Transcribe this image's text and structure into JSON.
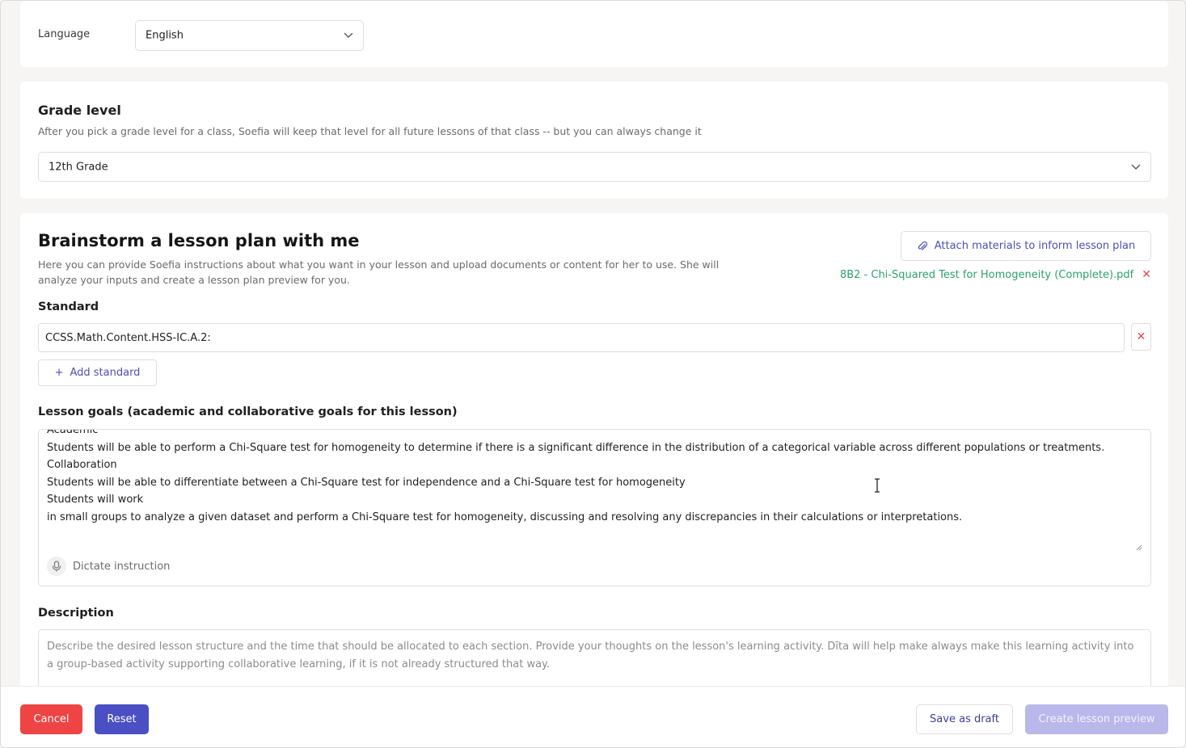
{
  "language": {
    "label": "Language",
    "value": "English"
  },
  "grade": {
    "title": "Grade level",
    "subtitle": "After you pick a grade level for a class, Soefia will keep that level for all future lessons of that class -- but you can always change it",
    "value": "12th Grade"
  },
  "brainstorm": {
    "title": "Brainstorm a lesson plan with me",
    "subtitle": "Here you can provide Soefia instructions about what you want in your lesson and upload documents or content for her to use. She will analyze your inputs and create a lesson plan preview for you.",
    "attach_label": "Attach materials to inform lesson plan",
    "attached_file": "8B2 - Chi-Squared Test for Homogeneity (Complete).pdf",
    "remove_symbol": "✕"
  },
  "standard": {
    "label": "Standard",
    "value": "CCSS.Math.Content.HSS-IC.A.2:",
    "add_label": "Add standard",
    "add_symbol": "+"
  },
  "goals": {
    "label": "Lesson goals (academic and collaborative goals for this lesson)",
    "lines": [
      "Academic",
      "Students will be able to perform a Chi-Square test for homogeneity to determine if there is a significant difference in the distribution of a categorical variable across different populations or treatments.",
      "Collaboration",
      "Students will be able to differentiate between a Chi-Square test for independence and a Chi-Square test for homogeneity",
      "Students will work",
      "in small groups to analyze a given dataset and perform a Chi-Square test for homogeneity, discussing and resolving any discrepancies in their calculations or interpretations."
    ],
    "dictate_label": "Dictate instruction"
  },
  "description": {
    "label": "Description",
    "placeholder": "Describe the desired lesson structure and the time that should be allocated to each section.  Provide your thoughts on the lesson's learning activity.  Dīta will help make always make this learning activity into a group-based activity supporting collaborative learning, if it is not already structured that way."
  },
  "footer": {
    "cancel": "Cancel",
    "reset": "Reset",
    "save_draft": "Save as draft",
    "create_preview": "Create lesson preview"
  },
  "colors": {
    "accent": "#4a4fc4",
    "danger": "#ef4444",
    "success": "#2aa36b",
    "disabled_primary": "#b9b8ea"
  }
}
